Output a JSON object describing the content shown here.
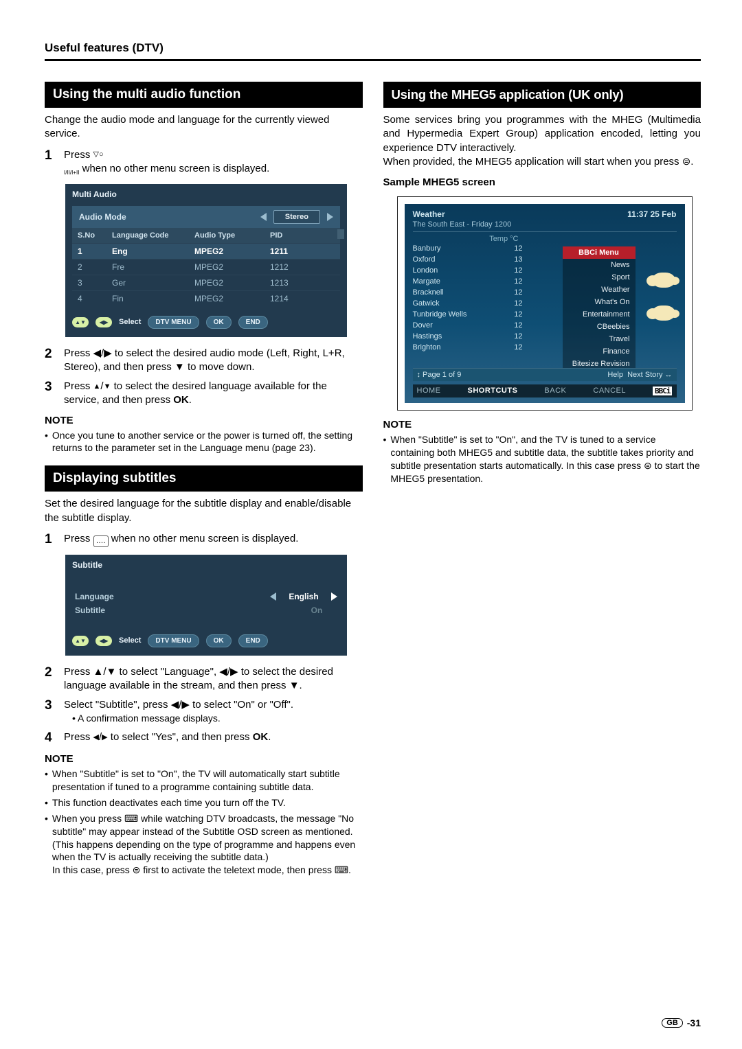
{
  "header": "Useful features (DTV)",
  "left": {
    "section1_title": "Using the multi audio function",
    "section1_intro": "Change the audio mode and language for the currently viewed service.",
    "step1": "Press",
    "step1_icon": "I/II/I+II",
    "step1_tail": "when no other menu screen is displayed.",
    "panel1": {
      "title": "Multi Audio",
      "mode_label": "Audio Mode",
      "mode_value": "Stereo",
      "cols": {
        "sno": "S.No",
        "lang": "Language Code",
        "atype": "Audio Type",
        "pid": "PID"
      },
      "rows": [
        {
          "sno": "1",
          "lang": "Eng",
          "atype": "MPEG2",
          "pid": "1211"
        },
        {
          "sno": "2",
          "lang": "Fre",
          "atype": "MPEG2",
          "pid": "1212"
        },
        {
          "sno": "3",
          "lang": "Ger",
          "atype": "MPEG2",
          "pid": "1213"
        },
        {
          "sno": "4",
          "lang": "Fin",
          "atype": "MPEG2",
          "pid": "1214"
        }
      ],
      "footer": {
        "select": "Select",
        "dtv": "DTV MENU",
        "ok": "OK",
        "end": "END"
      }
    },
    "step2": "Press ◀/▶ to select the desired audio mode (Left, Right, L+R, Stereo), and then press ▼ to move down.",
    "step3": "Press ▲/▼ to select the desired language available for the service, and then press OK.",
    "note1_hd": "NOTE",
    "note1_items": [
      "Once you tune to another service or the power is turned off, the setting returns to the parameter set in the Language menu (page 23)."
    ],
    "section2_title": "Displaying subtitles",
    "section2_intro": "Set the desired language for the subtitle display and enable/disable the subtitle display.",
    "sub_step1_a": "Press",
    "sub_step1_b": "when no other menu screen is displayed.",
    "panel2": {
      "title": "Subtitle",
      "row1_label": "Language",
      "row1_value": "English",
      "row2_label": "Subtitle",
      "row2_value": "On",
      "footer": {
        "select": "Select",
        "dtv": "DTV MENU",
        "ok": "OK",
        "end": "END"
      }
    },
    "sub_step2": "Press ▲/▼ to select \"Language\", ◀/▶ to select the desired language available in the stream, and then press ▼.",
    "sub_step3": "Select \"Subtitle\", press ◀/▶ to select \"On\" or \"Off\".",
    "sub_step3_sub": "A confirmation message displays.",
    "sub_step4": "Press ◀/▶ to select \"Yes\", and then press OK.",
    "note2_hd": "NOTE",
    "note2_items": [
      "When \"Subtitle\" is set to \"On\", the TV will automatically start subtitle presentation if tuned to a programme containing subtitle data.",
      "This function deactivates each time you turn off the TV.",
      "When you press ⌨ while watching DTV broadcasts, the message \"No subtitle\" may appear instead of the Subtitle OSD screen as mentioned. (This happens depending on the type of programme and happens even when the TV is actually receiving the subtitle data.)\nIn this case, press ⊜ first to activate the teletext mode, then press ⌨."
    ]
  },
  "right": {
    "section_title": "Using the MHEG5 application (UK only)",
    "intro": "Some services bring you programmes with the MHEG (Multimedia and Hypermedia Expert Group) application encoded, letting you experience DTV interactively.\nWhen provided, the MHEG5 application will start when you press ⊜.",
    "sample_hd": "Sample MHEG5 screen",
    "mheg": {
      "title": "Weather",
      "time": "11:37  25 Feb",
      "subtitle": "The South East - Friday 1200",
      "col_hdr": "Temp °C",
      "rows": [
        {
          "n": "Banbury",
          "t": "12"
        },
        {
          "n": "Oxford",
          "t": "13"
        },
        {
          "n": "London",
          "t": "12"
        },
        {
          "n": "Margate",
          "t": "12"
        },
        {
          "n": "Bracknell",
          "t": "12"
        },
        {
          "n": "Gatwick",
          "t": "12"
        },
        {
          "n": "Tunbridge Wells",
          "t": "12"
        },
        {
          "n": "Dover",
          "t": "12"
        },
        {
          "n": "Hastings",
          "t": "12"
        },
        {
          "n": "Brighton",
          "t": "12"
        }
      ],
      "menu_hd": "BBCi Menu",
      "menu_items": [
        "News",
        "Sport",
        "Weather",
        "What's On",
        "Entertainment",
        "CBeebies",
        "Travel",
        "Finance",
        "Bitesize Revision"
      ],
      "page": "↕ Page 1 of 9",
      "help": "Help",
      "next": "Next Story ↔",
      "bot": [
        "HOME",
        "SHORTCUTS",
        "BACK",
        "CANCEL"
      ],
      "logo": "BBCi"
    },
    "note_hd": "NOTE",
    "note_items": [
      "When \"Subtitle\" is set to \"On\", and the TV is tuned to a service containing both MHEG5 and subtitle data, the subtitle takes priority and subtitle presentation starts automatically. In this case press ⊜ to start the MHEG5 presentation."
    ]
  },
  "footer": {
    "gb": "GB",
    "page": "-31"
  }
}
